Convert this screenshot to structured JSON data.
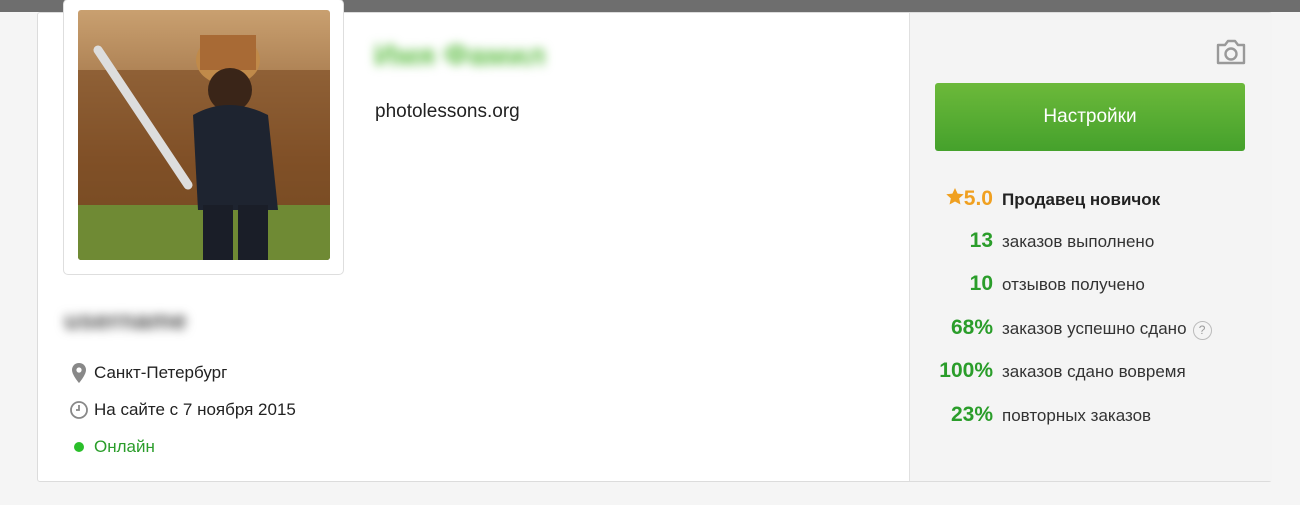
{
  "profile": {
    "name_blurred": "",
    "username_blurred": "",
    "website": "photolessons.org"
  },
  "info": {
    "location": "Санкт-Петербург",
    "member_since": "На сайте с 7 ноября 2015",
    "status": "Онлайн"
  },
  "sidebar": {
    "settings_label": "Настройки",
    "rating_value": "5.0",
    "rating_label": "Продавец новичок",
    "stats": [
      {
        "value": "13",
        "label": "заказов выполнено"
      },
      {
        "value": "10",
        "label": "отзывов получено"
      },
      {
        "value": "68%",
        "label": "заказов успешно сдано"
      },
      {
        "value": "100%",
        "label": "заказов сдано вовремя"
      },
      {
        "value": "23%",
        "label": "повторных заказов"
      }
    ],
    "help_glyph": "?"
  },
  "colors": {
    "accent_green": "#2a9d2a",
    "button_green": "#4fa82f",
    "star": "#f0a020",
    "online_dot": "#2abf2a"
  },
  "icons": [
    "camera-icon",
    "location-pin-icon",
    "clock-icon",
    "online-dot-icon",
    "star-icon",
    "help-icon"
  ]
}
